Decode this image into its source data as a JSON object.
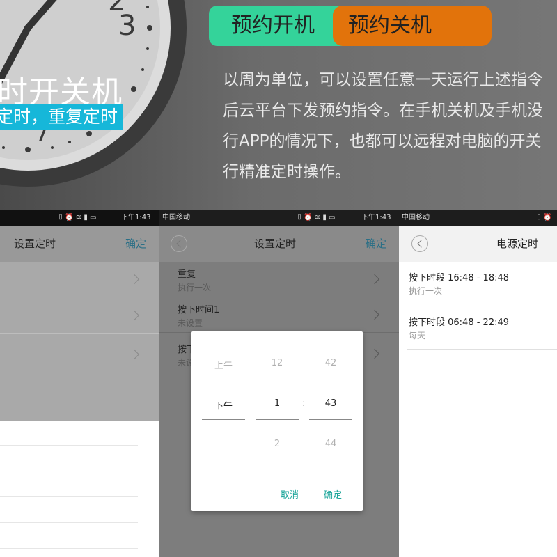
{
  "banner": {
    "tab_on": "预约开机",
    "tab_off": "预约关机",
    "title": "时开关机",
    "subtitle": "定时，重复定时",
    "description_lines": [
      "以周为单位，可以设置任意一天运行上述指令",
      "后云平台下发预约指令。在手机关机及手机没",
      "行APP的情况下，也都可以远程对电脑的开关",
      "行精准定时操作。"
    ],
    "colors": {
      "tab_on": "#34d39a",
      "tab_off": "#e2730b",
      "subtitle_bg": "#16b7d9"
    }
  },
  "panel1": {
    "status": {
      "time": "下午1:43"
    },
    "nav": {
      "title": "设置定时",
      "confirm": "确定"
    }
  },
  "panel2": {
    "status": {
      "carrier": "中国移动",
      "time": "下午1:43"
    },
    "nav": {
      "title": "设置定时",
      "confirm": "确定"
    },
    "rows": [
      {
        "label": "重复",
        "value": "执行一次"
      },
      {
        "label": "按下时间1",
        "value": "未设置"
      },
      {
        "label": "按下",
        "value": "未设"
      }
    ],
    "picker": {
      "ampm": {
        "above": "上午",
        "selected": "下午"
      },
      "hour": {
        "above": "12",
        "selected": "1",
        "below": "2"
      },
      "separator": ":",
      "minute": {
        "above": "42",
        "selected": "43",
        "below": "44"
      },
      "cancel": "取消",
      "ok": "确定"
    }
  },
  "panel3": {
    "status": {
      "carrier": "中国移动"
    },
    "nav": {
      "title": "电源定时"
    },
    "items": [
      {
        "title": "按下时段  16:48 - 18:48",
        "repeat": "执行一次"
      },
      {
        "title": "按下时段  06:48 - 22:49",
        "repeat": "每天"
      }
    ]
  }
}
